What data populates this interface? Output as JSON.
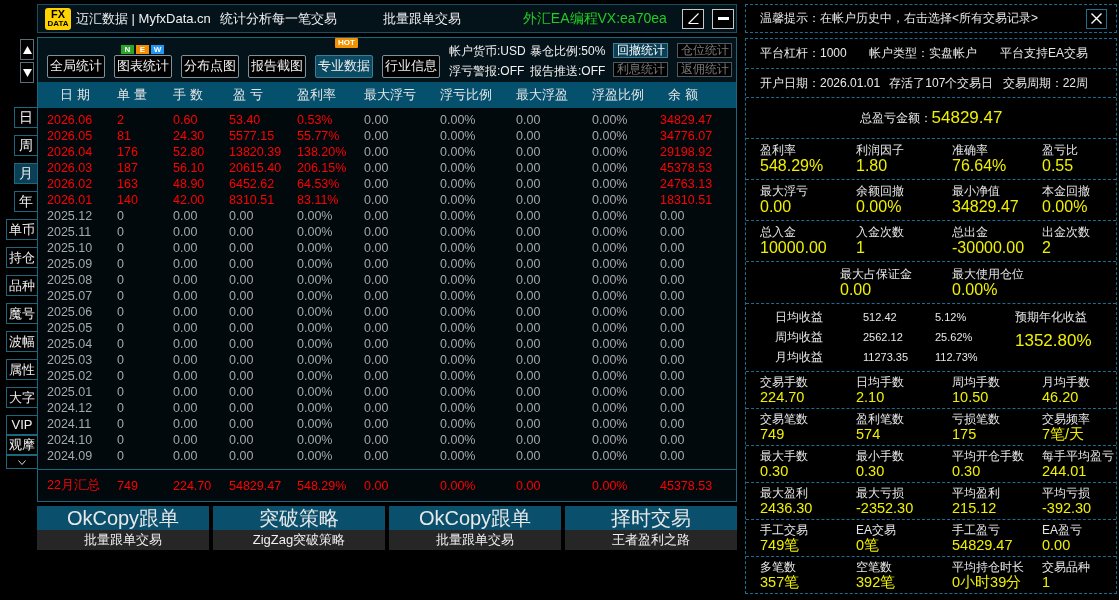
{
  "title_bar": {
    "logo_top": "FX",
    "logo_bottom": "DATA",
    "brand": "迈汇数据 | MyfxData.cn",
    "slogan": "统计分析每一笔交易",
    "center_title": "批量跟单交易",
    "contact": "外汇EA编程VX:ea70ea"
  },
  "period_tabs": [
    {
      "label": "日",
      "selected": false
    },
    {
      "label": "周",
      "selected": false
    },
    {
      "label": "月",
      "selected": true
    },
    {
      "label": "年",
      "selected": false
    }
  ],
  "side_buttons": [
    "单币",
    "持仓",
    "品种",
    "魔号",
    "波幅",
    "属性",
    "大字"
  ],
  "side_buttons_compact": [
    "VIP",
    "观摩"
  ],
  "toolbar": {
    "tabs": [
      {
        "label": "全局统计",
        "selected": false
      },
      {
        "label": "图表统计",
        "selected": false,
        "badge": {
          "kind": "new",
          "letters": [
            {
              "text": "N",
              "color": "#2aa52a"
            },
            {
              "text": "E",
              "color": "#f28c00"
            },
            {
              "text": "W",
              "color": "#2196f3"
            }
          ]
        }
      },
      {
        "label": "分布点图",
        "selected": false
      },
      {
        "label": "报告截图",
        "selected": false
      },
      {
        "label": "专业数据",
        "selected": true,
        "badge": {
          "kind": "hot",
          "text": "HOT"
        }
      },
      {
        "label": "行业信息",
        "selected": false
      }
    ]
  },
  "account_settings": [
    "帐户货币:USD",
    "暴仓比例:50%",
    "浮亏警报:OFF",
    "报告推送:OFF"
  ],
  "stat_buttons": [
    {
      "label": "回撤统计",
      "selected": true
    },
    {
      "label": "仓位统计",
      "selected": false
    },
    {
      "label": "利息统计",
      "selected": false
    },
    {
      "label": "返佣统计",
      "selected": false
    }
  ],
  "table": {
    "columns": [
      {
        "label": "日 期",
        "tinted": true
      },
      {
        "label": "单 量",
        "tinted": true
      },
      {
        "label": "手 数",
        "tinted": true
      },
      {
        "label": "盈 亏",
        "tinted": true
      },
      {
        "label": "盈利率",
        "tinted": true
      },
      {
        "label": "最大浮亏",
        "tinted": false
      },
      {
        "label": "浮亏比例",
        "tinted": false
      },
      {
        "label": "最大浮盈",
        "tinted": false
      },
      {
        "label": "浮盈比例",
        "tinted": false
      },
      {
        "label": "余 额",
        "tinted": true
      }
    ],
    "rows": [
      {
        "highlighted": true,
        "cells": [
          "2026.06",
          "2",
          "0.60",
          "53.40",
          "0.53%",
          "0.00",
          "0.00%",
          "0.00",
          "0.00%",
          "34829.47"
        ]
      },
      {
        "highlighted": true,
        "cells": [
          "2026.05",
          "81",
          "24.30",
          "5577.15",
          "55.77%",
          "0.00",
          "0.00%",
          "0.00",
          "0.00%",
          "34776.07"
        ]
      },
      {
        "highlighted": true,
        "cells": [
          "2026.04",
          "176",
          "52.80",
          "13820.39",
          "138.20%",
          "0.00",
          "0.00%",
          "0.00",
          "0.00%",
          "29198.92"
        ]
      },
      {
        "highlighted": true,
        "cells": [
          "2026.03",
          "187",
          "56.10",
          "20615.40",
          "206.15%",
          "0.00",
          "0.00%",
          "0.00",
          "0.00%",
          "45378.53"
        ]
      },
      {
        "highlighted": true,
        "cells": [
          "2026.02",
          "163",
          "48.90",
          "6452.62",
          "64.53%",
          "0.00",
          "0.00%",
          "0.00",
          "0.00%",
          "24763.13"
        ]
      },
      {
        "highlighted": true,
        "cells": [
          "2026.01",
          "140",
          "42.00",
          "8310.51",
          "83.11%",
          "0.00",
          "0.00%",
          "0.00",
          "0.00%",
          "18310.51"
        ]
      },
      {
        "highlighted": false,
        "cells": [
          "2025.12",
          "0",
          "0.00",
          "0.00",
          "0.00%",
          "0.00",
          "0.00%",
          "0.00",
          "0.00%",
          "0.00"
        ]
      },
      {
        "highlighted": false,
        "cells": [
          "2025.11",
          "0",
          "0.00",
          "0.00",
          "0.00%",
          "0.00",
          "0.00%",
          "0.00",
          "0.00%",
          "0.00"
        ]
      },
      {
        "highlighted": false,
        "cells": [
          "2025.10",
          "0",
          "0.00",
          "0.00",
          "0.00%",
          "0.00",
          "0.00%",
          "0.00",
          "0.00%",
          "0.00"
        ]
      },
      {
        "highlighted": false,
        "cells": [
          "2025.09",
          "0",
          "0.00",
          "0.00",
          "0.00%",
          "0.00",
          "0.00%",
          "0.00",
          "0.00%",
          "0.00"
        ]
      },
      {
        "highlighted": false,
        "cells": [
          "2025.08",
          "0",
          "0.00",
          "0.00",
          "0.00%",
          "0.00",
          "0.00%",
          "0.00",
          "0.00%",
          "0.00"
        ]
      },
      {
        "highlighted": false,
        "cells": [
          "2025.07",
          "0",
          "0.00",
          "0.00",
          "0.00%",
          "0.00",
          "0.00%",
          "0.00",
          "0.00%",
          "0.00"
        ]
      },
      {
        "highlighted": false,
        "cells": [
          "2025.06",
          "0",
          "0.00",
          "0.00",
          "0.00%",
          "0.00",
          "0.00%",
          "0.00",
          "0.00%",
          "0.00"
        ]
      },
      {
        "highlighted": false,
        "cells": [
          "2025.05",
          "0",
          "0.00",
          "0.00",
          "0.00%",
          "0.00",
          "0.00%",
          "0.00",
          "0.00%",
          "0.00"
        ]
      },
      {
        "highlighted": false,
        "cells": [
          "2025.04",
          "0",
          "0.00",
          "0.00",
          "0.00%",
          "0.00",
          "0.00%",
          "0.00",
          "0.00%",
          "0.00"
        ]
      },
      {
        "highlighted": false,
        "cells": [
          "2025.03",
          "0",
          "0.00",
          "0.00",
          "0.00%",
          "0.00",
          "0.00%",
          "0.00",
          "0.00%",
          "0.00"
        ]
      },
      {
        "highlighted": false,
        "cells": [
          "2025.02",
          "0",
          "0.00",
          "0.00",
          "0.00%",
          "0.00",
          "0.00%",
          "0.00",
          "0.00%",
          "0.00"
        ]
      },
      {
        "highlighted": false,
        "cells": [
          "2025.01",
          "0",
          "0.00",
          "0.00",
          "0.00%",
          "0.00",
          "0.00%",
          "0.00",
          "0.00%",
          "0.00"
        ]
      },
      {
        "highlighted": false,
        "cells": [
          "2024.12",
          "0",
          "0.00",
          "0.00",
          "0.00%",
          "0.00",
          "0.00%",
          "0.00",
          "0.00%",
          "0.00"
        ]
      },
      {
        "highlighted": false,
        "cells": [
          "2024.11",
          "0",
          "0.00",
          "0.00",
          "0.00%",
          "0.00",
          "0.00%",
          "0.00",
          "0.00%",
          "0.00"
        ]
      },
      {
        "highlighted": false,
        "cells": [
          "2024.10",
          "0",
          "0.00",
          "0.00",
          "0.00%",
          "0.00",
          "0.00%",
          "0.00",
          "0.00%",
          "0.00"
        ]
      },
      {
        "highlighted": false,
        "cells": [
          "2024.09",
          "0",
          "0.00",
          "0.00",
          "0.00%",
          "0.00",
          "0.00%",
          "0.00",
          "0.00%",
          "0.00"
        ]
      }
    ],
    "summary": [
      "22月汇总",
      "749",
      "224.70",
      "54829.47",
      "548.29%",
      "0.00",
      "0.00%",
      "0.00",
      "0.00%",
      "45378.53"
    ]
  },
  "promo_cards": [
    {
      "title": "OkCopy跟单",
      "subtitle": "批量跟单交易"
    },
    {
      "title": "突破策略",
      "subtitle": "ZigZag突破策略"
    },
    {
      "title": "OkCopy跟单",
      "subtitle": "批量跟单交易"
    },
    {
      "title": "择时交易",
      "subtitle": "王者盈利之路"
    }
  ],
  "stats_panel": {
    "tip": "温馨提示：在帐户历史中，右击选择<所有交易记录>",
    "sections": [
      {
        "kind": "info",
        "items": [
          "平台杠杆：1000",
          "帐户类型：实盘帐户",
          "平台支持EA交易"
        ]
      },
      {
        "kind": "info",
        "items": [
          "开户日期：2026.01.01",
          "存活了107个交易日",
          "交易周期：22周"
        ]
      },
      {
        "kind": "total",
        "label": "总盈亏金额：",
        "value": "54829.47"
      },
      {
        "kind": "big_metrics",
        "items": [
          {
            "label": "盈利率",
            "value": "548.29%"
          },
          {
            "label": "利润因子",
            "value": "1.80"
          },
          {
            "label": "准确率",
            "value": "76.64%"
          },
          {
            "label": "盈亏比",
            "value": "0.55"
          }
        ]
      },
      {
        "kind": "big_metrics",
        "items": [
          {
            "label": "最大浮亏",
            "value": "0.00"
          },
          {
            "label": "余额回撤",
            "value": "0.00%"
          },
          {
            "label": "最小净值",
            "value": "34829.47"
          },
          {
            "label": "本金回撤",
            "value": "0.00%"
          }
        ]
      },
      {
        "kind": "big_metrics",
        "items": [
          {
            "label": "总入金",
            "value": "10000.00"
          },
          {
            "label": "入金次数",
            "value": "1"
          },
          {
            "label": "总出金",
            "value": "-30000.00"
          },
          {
            "label": "出金次数",
            "value": "2"
          }
        ]
      },
      {
        "kind": "pair",
        "items": [
          {
            "label": "最大占保证金",
            "value": "0.00"
          },
          {
            "label": "最大使用仓位",
            "value": "0.00%"
          }
        ]
      },
      {
        "kind": "returns",
        "rows": [
          {
            "label": "日均收益",
            "amount": "512.42",
            "percent": "5.12%"
          },
          {
            "label": "周均收益",
            "amount": "2562.12",
            "percent": "25.62%"
          },
          {
            "label": "月均收益",
            "amount": "11273.35",
            "percent": "112.73%"
          }
        ],
        "annual": {
          "label": "预期年化收益",
          "value": "1352.80%"
        }
      },
      {
        "kind": "metrics",
        "items": [
          {
            "label": "交易手数",
            "value": "224.70"
          },
          {
            "label": "日均手数",
            "value": "2.10"
          },
          {
            "label": "周均手数",
            "value": "10.50"
          },
          {
            "label": "月均手数",
            "value": "46.20"
          }
        ]
      },
      {
        "kind": "metrics",
        "items": [
          {
            "label": "交易笔数",
            "value": "749"
          },
          {
            "label": "盈利笔数",
            "value": "574"
          },
          {
            "label": "亏损笔数",
            "value": "175"
          },
          {
            "label": "交易频率",
            "value": "7笔/天"
          }
        ]
      },
      {
        "kind": "metrics",
        "items": [
          {
            "label": "最大手数",
            "value": "0.30"
          },
          {
            "label": "最小手数",
            "value": "0.30"
          },
          {
            "label": "平均开仓手数",
            "value": "0.30"
          },
          {
            "label": "每手平均盈亏",
            "value": "244.01"
          }
        ]
      },
      {
        "kind": "metrics",
        "items": [
          {
            "label": "最大盈利",
            "value": "2436.30"
          },
          {
            "label": "最大亏损",
            "value": "-2352.30"
          },
          {
            "label": "平均盈利",
            "value": "215.12"
          },
          {
            "label": "平均亏损",
            "value": "-392.30"
          }
        ]
      },
      {
        "kind": "metrics",
        "items": [
          {
            "label": "手工交易",
            "value": "749笔"
          },
          {
            "label": "EA交易",
            "value": "0笔"
          },
          {
            "label": "手工盈亏",
            "value": "54829.47"
          },
          {
            "label": "EA盈亏",
            "value": "0.00"
          }
        ]
      },
      {
        "kind": "metrics",
        "items": [
          {
            "label": "多笔数",
            "value": "357笔"
          },
          {
            "label": "空笔数",
            "value": "392笔"
          },
          {
            "label": "平均持仓时长",
            "value": "0小时39分"
          },
          {
            "label": "交易品种",
            "value": "1"
          }
        ]
      }
    ]
  }
}
